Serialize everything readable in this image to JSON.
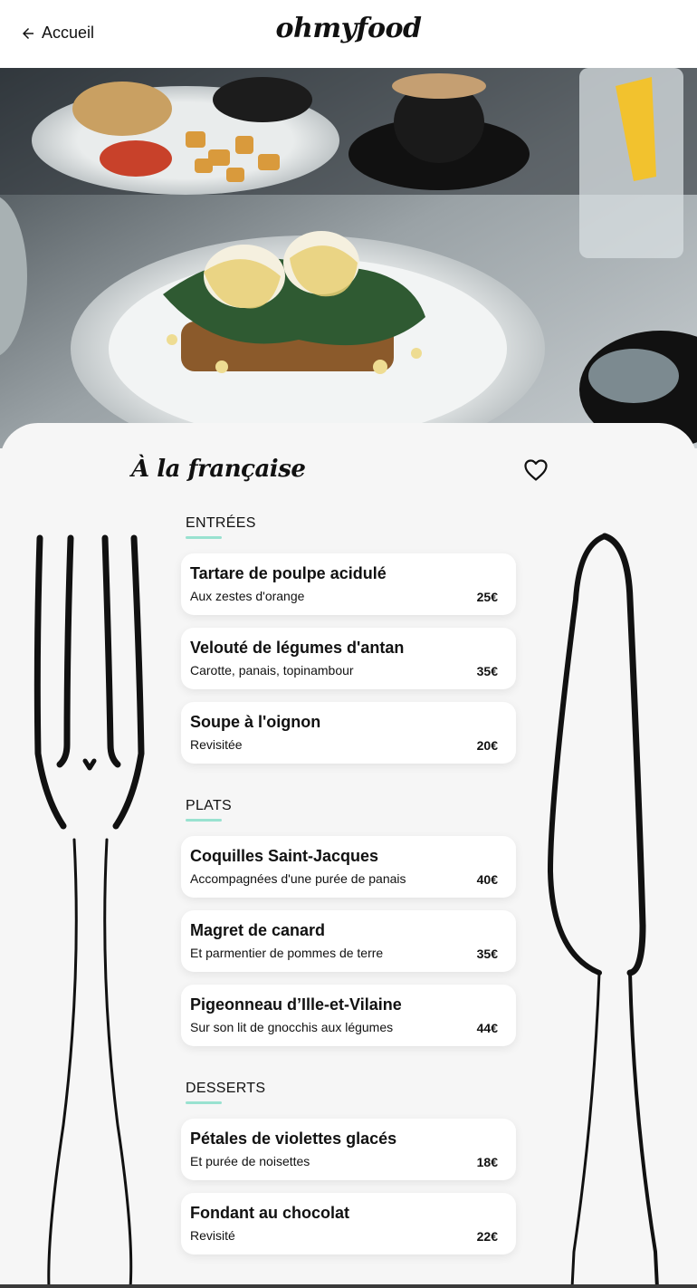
{
  "header": {
    "back_label": "Accueil",
    "logo": "ohmyfood"
  },
  "hero": {
    "description_icon": "food-photo"
  },
  "restaurant": {
    "name": "À la française",
    "favorite_icon": "heart-icon"
  },
  "menu": {
    "sections": [
      {
        "title": "ENTRÉES",
        "dishes": [
          {
            "name": "Tartare de poulpe acidulé",
            "desc": "Aux zestes d'orange",
            "price": "25€"
          },
          {
            "name": "Velouté de légumes d'antan",
            "desc": "Carotte, panais, topinambour",
            "price": "35€"
          },
          {
            "name": "Soupe à l'oignon",
            "desc": "Revisitée",
            "price": "20€"
          }
        ]
      },
      {
        "title": "PLATS",
        "dishes": [
          {
            "name": "Coquilles Saint-Jacques",
            "desc": "Accompagnées d'une purée de panais",
            "price": "40€"
          },
          {
            "name": "Magret de canard",
            "desc": "Et parmentier de pommes de terre",
            "price": "35€"
          },
          {
            "name": "Pigeonneau d’Ille-et-Vilaine",
            "desc": "Sur son lit de gnocchis aux légumes",
            "price": "44€"
          }
        ]
      },
      {
        "title": "DESSERTS",
        "dishes": [
          {
            "name": "Pétales de violettes glacés",
            "desc": "Et purée de noisettes",
            "price": "18€"
          },
          {
            "name": "Fondant au chocolat",
            "desc": "Revisité",
            "price": "22€"
          }
        ]
      }
    ]
  },
  "colors": {
    "accent": "#99e2d0",
    "background": "#f6f6f6"
  }
}
